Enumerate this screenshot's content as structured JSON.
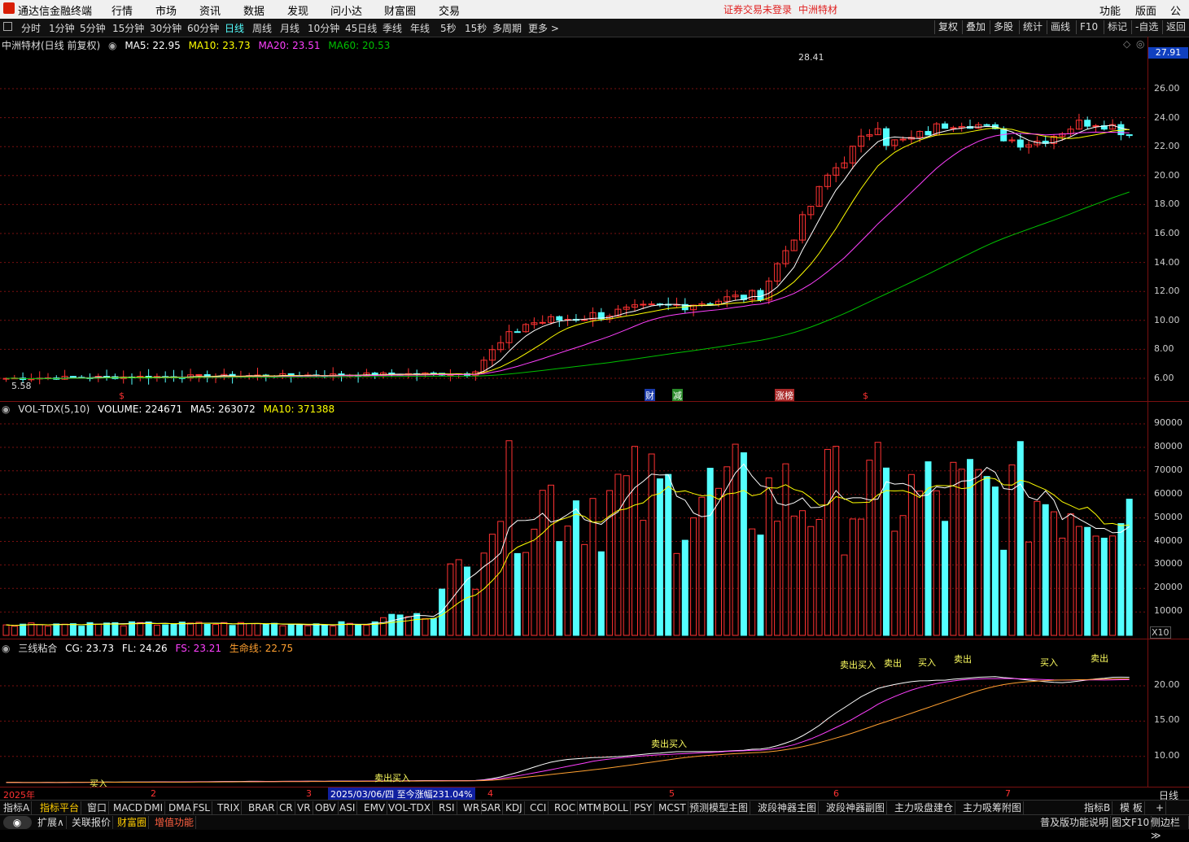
{
  "app": {
    "logo_text": "通达信金融终端",
    "menu": [
      "行情",
      "市场",
      "资讯",
      "数据",
      "发现",
      "问小达",
      "财富圈",
      "交易"
    ],
    "notice": "证券交易未登录",
    "stock_name": "中洲特材",
    "right_menu": [
      "功能",
      "版面",
      "公式"
    ]
  },
  "periods": [
    "分时",
    "1分钟",
    "5分钟",
    "15分钟",
    "30分钟",
    "60分钟",
    "日线",
    "周线",
    "月线",
    "10分钟",
    "45日线",
    "季线",
    "年线",
    "5秒",
    "15秒",
    "多周期",
    "更多 >"
  ],
  "active_period": "日线",
  "tools": [
    "复权",
    "叠加",
    "多股",
    "统计",
    "画线",
    "F10",
    "-自选",
    "返回"
  ],
  "tools_mark": "标记",
  "price_panel": {
    "title": "中洲特材(日线 前复权)",
    "ma5": "MA5: 22.95",
    "ma10": "MA10: 23.73",
    "ma20": "MA20: 23.51",
    "ma60": "MA60: 20.53",
    "current_price": "27.91",
    "high_label": "28.41",
    "low_label": "5.58",
    "yaxis": [
      "26.00",
      "24.00",
      "22.00",
      "20.00",
      "18.00",
      "16.00",
      "14.00",
      "12.00",
      "10.00",
      "8.00",
      "6.00"
    ],
    "markers": [
      "$",
      "财",
      "减",
      "涨榜",
      "$"
    ]
  },
  "vol_panel": {
    "title": "VOL-TDX(5,10)",
    "volume": "VOLUME: 224671",
    "ma5": "MA5: 263072",
    "ma10": "MA10: 371388",
    "yaxis": [
      "90000",
      "80000",
      "70000",
      "60000",
      "50000",
      "40000",
      "30000",
      "20000",
      "10000"
    ],
    "unit": "X10"
  },
  "ind_panel": {
    "title": "三线粘合",
    "cg": "CG: 23.73",
    "fl": "FL: 24.26",
    "fs": "FS: 23.21",
    "life": "生命线: 22.75",
    "yaxis": [
      "20.00",
      "15.00",
      "10.00"
    ],
    "signals": [
      "买入",
      "卖出买入",
      "卖出买入",
      "卖出买入",
      "卖出",
      "买入",
      "卖出",
      "买入",
      "卖出"
    ]
  },
  "timeline": {
    "labels": [
      "2025年",
      "2",
      "3",
      "4",
      "5",
      "6",
      "7"
    ],
    "info": "2025/03/06/四  至今涨幅231.04%",
    "period": "日线"
  },
  "bottom_tabs": [
    "指标A",
    "指标平台",
    "窗口",
    "MACD",
    "DMI",
    "DMA",
    "FSL",
    "TRIX",
    "BRAR",
    "CR",
    "VR",
    "OBV",
    "ASI",
    "EMV",
    "VOL-TDX",
    "RSI",
    "WR",
    "SAR",
    "KDJ",
    "CCI",
    "ROC",
    "MTM",
    "BOLL",
    "PSY",
    "MCST",
    "预测模型主图",
    "波段神器主图",
    "波段神器副图",
    "主力吸盘建仓",
    "主力吸筹附图"
  ],
  "bottom_right": [
    "指标B",
    "模 板",
    "+"
  ],
  "status_tabs": [
    "扩展∧",
    "关联报价",
    "财富圈",
    "增值功能"
  ],
  "status_right": [
    "普及版功能说明",
    "图文F10",
    "侧边栏≫"
  ],
  "colors": {
    "up": "#ff3232",
    "down": "#54ffff",
    "ma5": "#ffffff",
    "ma10": "#ffff00",
    "ma20": "#ff40ff",
    "ma60": "#00c000",
    "grid": "#7a1010"
  }
}
